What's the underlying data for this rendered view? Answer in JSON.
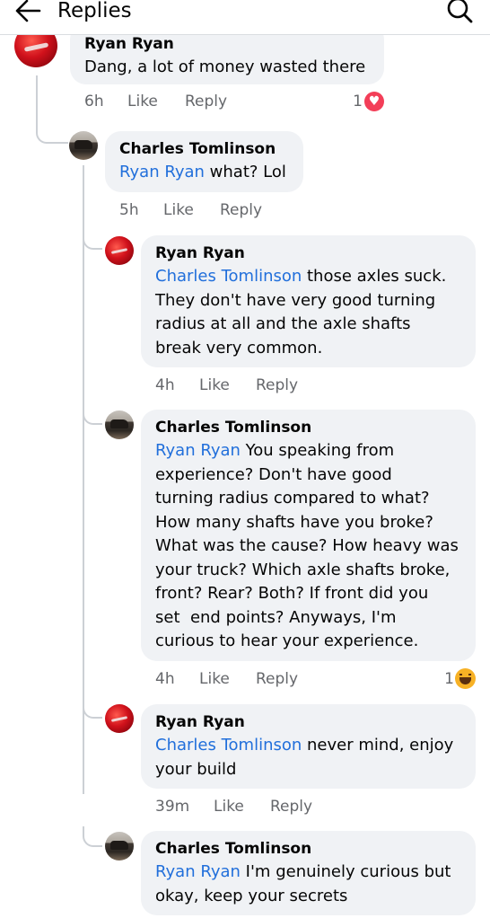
{
  "header": {
    "title": "Replies",
    "back_icon": "arrow-left-icon",
    "search_icon": "search-icon"
  },
  "colors": {
    "mention": "#216fdb",
    "bubble": "#f0f2f5",
    "meta": "#65676b",
    "heart": "#f33e58",
    "haha": "#f7b125"
  },
  "comments": [
    {
      "author": "Ryan Ryan",
      "mention": "",
      "text": "Dang, a lot of money wasted there",
      "time": "6h",
      "like": "Like",
      "reply": "Reply",
      "reaction_count": "1",
      "reaction": "heart-icon"
    },
    {
      "author": "Charles Tomlinson",
      "mention": "Ryan Ryan",
      "text": " what? Lol",
      "time": "5h",
      "like": "Like",
      "reply": "Reply"
    },
    {
      "author": "Ryan Ryan",
      "mention": "Charles Tomlinson",
      "text": " those axles suck.\nThey don't have very good turning\nradius at all and the axle shafts\nbreak very common.",
      "time": "4h",
      "like": "Like",
      "reply": "Reply"
    },
    {
      "author": "Charles Tomlinson",
      "mention": "Ryan Ryan",
      "text": " You speaking from\nexperience? Don't have good\nturning radius compared to what?\nHow many shafts have you broke?\nWhat was the cause? How heavy was\nyour truck? Which axle shafts broke,\nfront? Rear? Both? If front did you\nset  end points? Anyways, I'm\ncurious to hear your experience.",
      "time": "4h",
      "like": "Like",
      "reply": "Reply",
      "reaction_count": "1",
      "reaction": "haha-icon"
    },
    {
      "author": "Ryan Ryan",
      "mention": "Charles Tomlinson",
      "text": " never mind, enjoy\nyour build",
      "time": "39m",
      "like": "Like",
      "reply": "Reply"
    },
    {
      "author": "Charles Tomlinson",
      "mention": "Ryan Ryan",
      "text": " I'm genuinely curious but\nokay, keep your secrets"
    }
  ]
}
